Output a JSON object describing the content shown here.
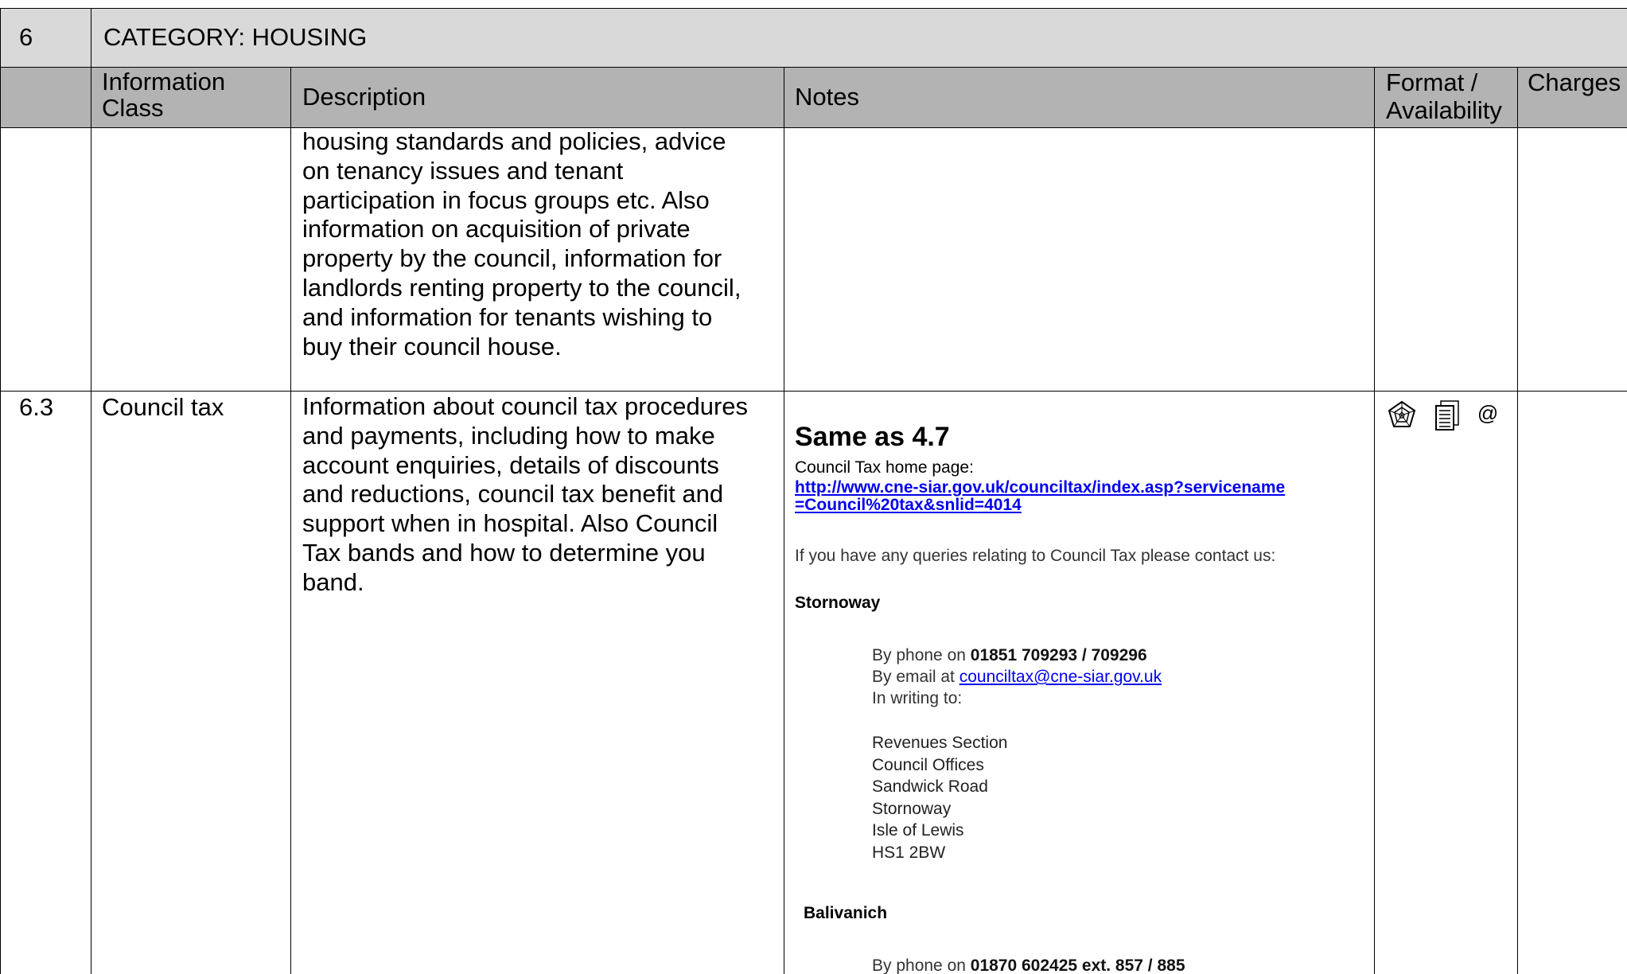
{
  "category": {
    "number": "6",
    "title": "CATEGORY:  HOUSING"
  },
  "columns": {
    "info_class": [
      "Information",
      "Class"
    ],
    "description": "Description",
    "notes": "Notes",
    "format": [
      "Format /",
      "Availability"
    ],
    "charges": "Charges"
  },
  "continued_row": {
    "description_lines": [
      "housing standards and policies, advice",
      "on tenancy issues and tenant",
      "participation in focus groups etc. Also",
      "information on acquisition of private",
      "property by the council, information for",
      "landlords renting property to the council,",
      "and information for tenants wishing to",
      "buy their council house."
    ]
  },
  "row_6_3": {
    "number": "6.3",
    "info_class": "Council tax",
    "description_lines": [
      "Information about council tax procedures",
      "and payments, including how to make",
      "account enquiries, details of discounts",
      "and reductions, council tax benefit and",
      "support when in hospital. Also Council",
      "Tax bands and how to determine you",
      "band."
    ],
    "notes": {
      "title": "Same as 4.7",
      "homepage_label": "Council Tax home page:",
      "homepage_link_lines": [
        "http://www.cne-siar.gov.uk/counciltax/index.asp?servicename",
        "=Council%20tax&snlid=4014"
      ],
      "queries_text": "If you have any queries relating to Council Tax please contact us:",
      "stornoway": {
        "heading": "Stornoway",
        "phone_prefix": "By phone on ",
        "phone": "01851 709293 / 709296",
        "email_prefix": "By email at ",
        "email": "counciltax@cne-siar.gov.uk",
        "writing": "In writing to:",
        "address": [
          "Revenues Section",
          "Council Offices",
          "Sandwick Road",
          "Stornoway",
          "Isle of Lewis",
          "HS1 2BW"
        ]
      },
      "balivanich": {
        "heading": "Balivanich",
        "phone_prefix": "By phone on ",
        "phone": "01870 602425 ext. 857 / 885"
      }
    },
    "format_icons": [
      "web-icon",
      "paper-document-icon",
      "email-icon"
    ]
  }
}
